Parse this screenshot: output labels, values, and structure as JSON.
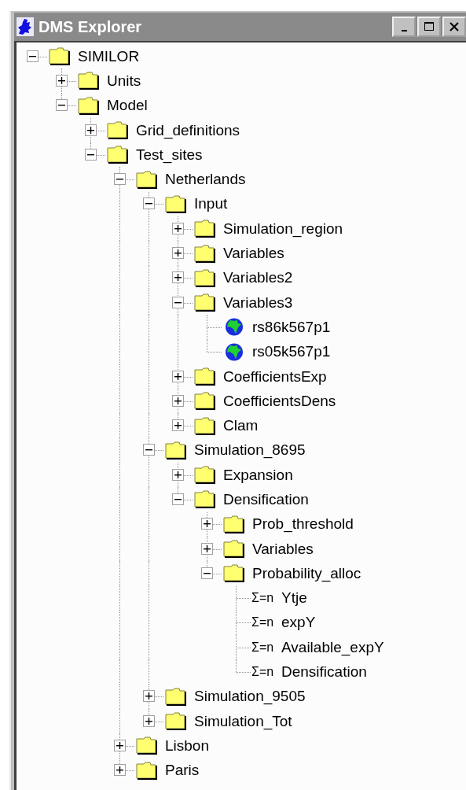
{
  "window": {
    "title": "DMS Explorer"
  },
  "tree": [
    {
      "label": "SIMILOR",
      "kind": "folder",
      "expanded": true,
      "children": [
        {
          "label": "Units",
          "kind": "folder",
          "expanded": false
        },
        {
          "label": "Model",
          "kind": "folder",
          "expanded": true,
          "children": [
            {
              "label": "Grid_definitions",
              "kind": "folder",
              "expanded": false
            },
            {
              "label": "Test_sites",
              "kind": "folder",
              "expanded": true,
              "children": [
                {
                  "label": "Netherlands",
                  "kind": "folder",
                  "expanded": true,
                  "children": [
                    {
                      "label": "Input",
                      "kind": "folder",
                      "expanded": true,
                      "children": [
                        {
                          "label": "Simulation_region",
                          "kind": "folder",
                          "expanded": false
                        },
                        {
                          "label": "Variables",
                          "kind": "folder",
                          "expanded": false
                        },
                        {
                          "label": "Variables2",
                          "kind": "folder",
                          "expanded": false
                        },
                        {
                          "label": "Variables3",
                          "kind": "folder",
                          "expanded": true,
                          "children": [
                            {
                              "label": "rs86k567p1",
                              "kind": "grid"
                            },
                            {
                              "label": "rs05k567p1",
                              "kind": "grid"
                            }
                          ]
                        },
                        {
                          "label": "CoefficientsExp",
                          "kind": "folder",
                          "expanded": false
                        },
                        {
                          "label": "CoefficientsDens",
                          "kind": "folder",
                          "expanded": false
                        },
                        {
                          "label": "Clam",
                          "kind": "folder",
                          "expanded": false
                        }
                      ]
                    },
                    {
                      "label": "Simulation_8695",
                      "kind": "folder",
                      "expanded": true,
                      "children": [
                        {
                          "label": "Expansion",
                          "kind": "folder",
                          "expanded": false
                        },
                        {
                          "label": "Densification",
                          "kind": "folder",
                          "expanded": true,
                          "children": [
                            {
                              "label": "Prob_threshold",
                              "kind": "folder",
                              "expanded": false
                            },
                            {
                              "label": "Variables",
                              "kind": "folder",
                              "expanded": false
                            },
                            {
                              "label": "Probability_alloc",
                              "kind": "folder",
                              "expanded": true,
                              "children": [
                                {
                                  "label": "Ytje",
                                  "kind": "formula",
                                  "icon_text": "Σ=n"
                                },
                                {
                                  "label": "expY",
                                  "kind": "formula",
                                  "icon_text": "Σ=n"
                                },
                                {
                                  "label": "Available_expY",
                                  "kind": "formula",
                                  "icon_text": "Σ=n"
                                },
                                {
                                  "label": "Densification",
                                  "kind": "formula",
                                  "icon_text": "Σ=n"
                                }
                              ]
                            }
                          ]
                        }
                      ]
                    },
                    {
                      "label": "Simulation_9505",
                      "kind": "folder",
                      "expanded": false
                    },
                    {
                      "label": "Simulation_Tot",
                      "kind": "folder",
                      "expanded": false
                    }
                  ]
                },
                {
                  "label": "Lisbon",
                  "kind": "folder",
                  "expanded": false
                },
                {
                  "label": "Paris",
                  "kind": "folder",
                  "expanded": false
                }
              ]
            }
          ]
        }
      ]
    }
  ]
}
